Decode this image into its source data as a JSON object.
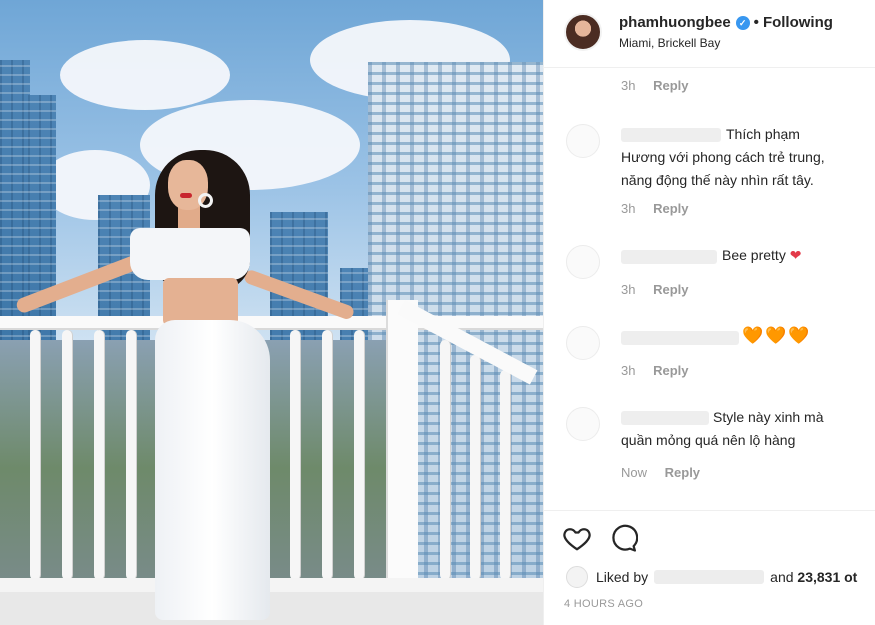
{
  "post": {
    "username": "phamhuongbee",
    "verified_icon": "verified-badge-icon",
    "separator": "•",
    "follow_status": "Following",
    "location": "Miami, Brickell Bay"
  },
  "comments": [
    {
      "text": "",
      "time": "3h",
      "reply": "Reply"
    },
    {
      "text": "Thích phạm Hương với phong cách trẻ trung, năng động thế này nhìn rất tây.",
      "time": "3h",
      "reply": "Reply"
    },
    {
      "text": "Bee pretty",
      "emoji": "❤",
      "time": "3h",
      "reply": "Reply"
    },
    {
      "text": "",
      "emoji": "🧡🧡🧡",
      "time": "3h",
      "reply": "Reply"
    },
    {
      "text": "Style này xinh mà quần mỏng quá nên lộ hàng",
      "time": "Now",
      "reply": "Reply"
    }
  ],
  "actions": {
    "like_icon": "heart-outline-icon",
    "comment_icon": "comment-bubble-icon"
  },
  "likes": {
    "prefix": "Liked by",
    "suffix_and": "and",
    "count_text": "23,831 ot"
  },
  "timestamp": "4 HOURS AGO",
  "colors": {
    "verified_blue": "#3897f0",
    "meta_gray": "#999999",
    "text_dark": "#262626"
  }
}
